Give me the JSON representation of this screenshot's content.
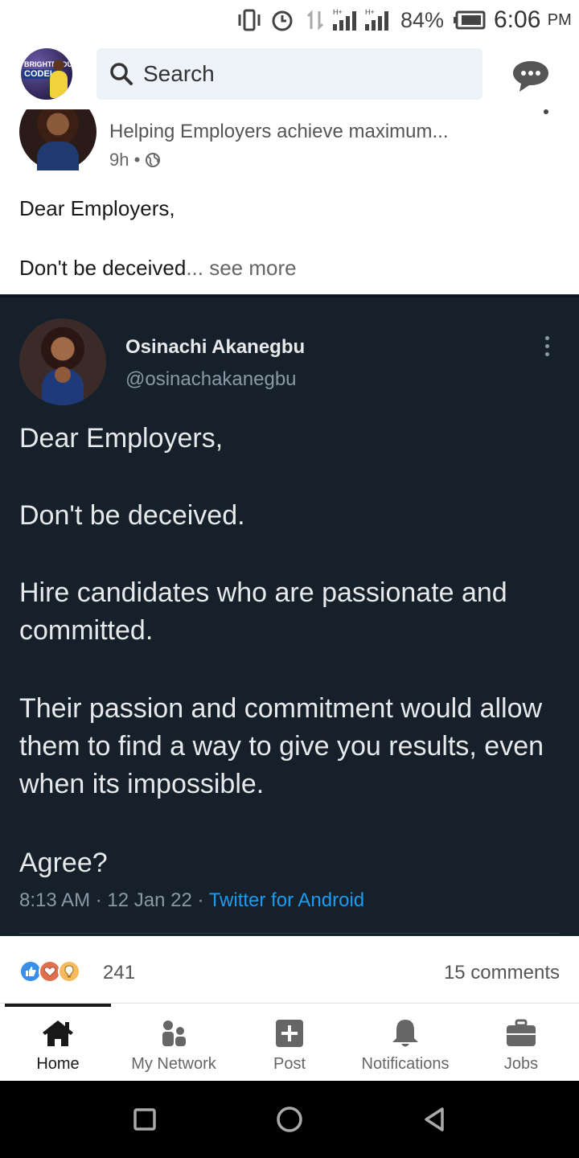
{
  "status_bar": {
    "battery_percent": "84%",
    "time": "6:06",
    "time_suffix": "PM"
  },
  "app_bar": {
    "search_placeholder": "Search",
    "avatar_text_top": "BRIGHTERDU",
    "avatar_text_bottom": "CODELA"
  },
  "post": {
    "headline": "Helping Employers achieve maximum...",
    "time_ago": "9h •",
    "text_line1": "Dear Employers,",
    "text_line2": "Don't be deceived",
    "see_more": "... see more"
  },
  "tweet": {
    "author_name": "Osinachi Akanegbu",
    "author_handle": "@osinachakanegbu",
    "line1": "Dear Employers,",
    "line2": "Don't be deceived.",
    "line3": "Hire candidates who are passionate and committed.",
    "line4": "Their passion and commitment would allow them to find a way to give you results, even when its impossible.",
    "line5": "Agree?",
    "meta_time": "8:13 AM · 12 Jan 22 · ",
    "meta_source": "Twitter for Android",
    "source_color": "#1d9bf0",
    "background_color": "#15202b"
  },
  "reactions": {
    "count": "241",
    "comments": "15 comments",
    "icons": [
      "like-icon",
      "love-icon",
      "insightful-icon"
    ]
  },
  "bottom_nav": {
    "items": [
      {
        "label": "Home",
        "icon": "home-icon",
        "active": true
      },
      {
        "label": "My Network",
        "icon": "network-icon",
        "active": false
      },
      {
        "label": "Post",
        "icon": "post-icon",
        "active": false
      },
      {
        "label": "Notifications",
        "icon": "bell-icon",
        "active": false
      },
      {
        "label": "Jobs",
        "icon": "briefcase-icon",
        "active": false
      }
    ]
  }
}
